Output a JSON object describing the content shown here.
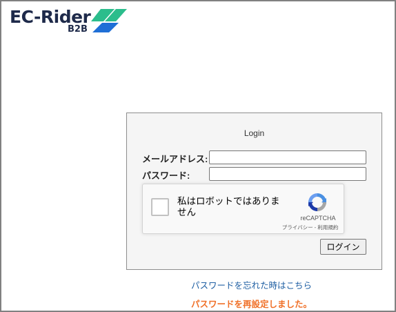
{
  "logo": {
    "text": "EC-Rider",
    "sub": "B2B",
    "colors": {
      "text": "#1e2a4a",
      "mark_green": "#2bbd8c",
      "mark_blue": "#1f6fd6"
    }
  },
  "login": {
    "title": "Login",
    "email_label": "メールアドレス:",
    "email_value": "",
    "password_label": "パスワード:",
    "password_value": "",
    "submit_label": "ログイン"
  },
  "recaptcha": {
    "checkbox_label": "私はロボットではありません",
    "checked": false,
    "brand": "reCAPTCHA",
    "terms": "プライバシー - 利用規約",
    "icon": "recaptcha-logo-icon"
  },
  "forgot_password_link": "パスワードを忘れた時はこちら",
  "reset_message": "パスワードを再設定しました。",
  "colors": {
    "link": "#1f5fa3",
    "message": "#f07028",
    "box_bg": "#f5f5f5"
  }
}
